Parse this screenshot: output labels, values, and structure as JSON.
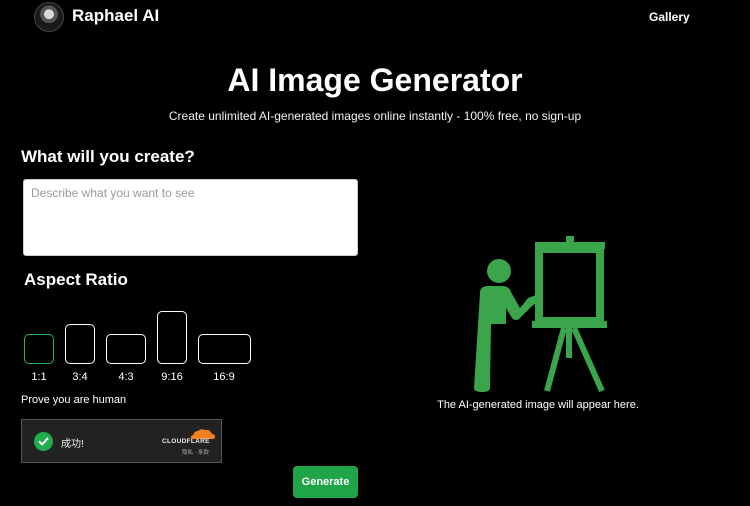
{
  "header": {
    "brand": "Raphael AI",
    "nav_gallery": "Gallery"
  },
  "hero": {
    "title": "AI Image Generator",
    "subtitle": "Create unlimited AI-generated images online instantly - 100% free, no sign-up"
  },
  "form": {
    "create_label": "What will you create?",
    "prompt_placeholder": "Describe what you want to see",
    "prompt_value": "",
    "aspect_label": "Aspect Ratio",
    "aspect_ratios": [
      "1:1",
      "3:4",
      "4:3",
      "9:16",
      "16:9"
    ],
    "selected_ratio": "1:1",
    "human_label": "Prove you are human",
    "generate_label": "Generate"
  },
  "captcha": {
    "status": "成功!",
    "brand": "CLOUDFLARE",
    "links": "隐私 · 条款"
  },
  "preview": {
    "placeholder_text": "The AI-generated image will appear here."
  },
  "colors": {
    "accent": "#1fa44a",
    "illustration": "#3aa54a",
    "selected_border": "#2fb24f"
  }
}
